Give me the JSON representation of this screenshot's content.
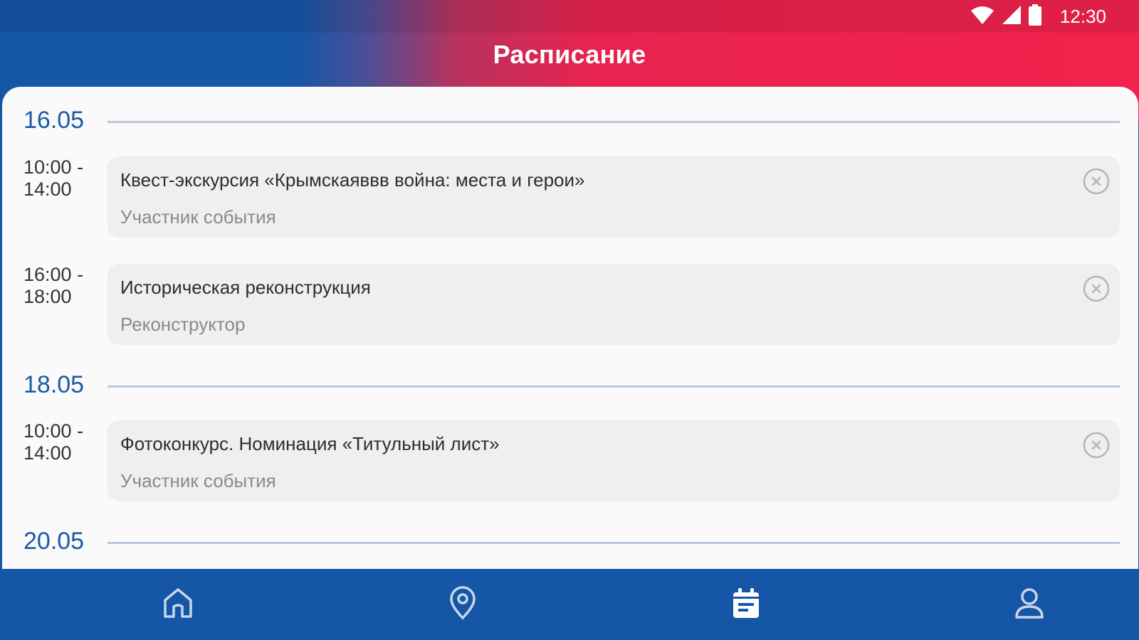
{
  "status_bar": {
    "time": "12:30",
    "icons": [
      "wifi-icon",
      "cellular-signal-icon",
      "battery-icon"
    ]
  },
  "header": {
    "title": "Расписание"
  },
  "schedule": [
    {
      "date": "16.05",
      "events": [
        {
          "time_start": "10:00 -",
          "time_end": "14:00",
          "title": "Квест-экскурсия «Крымскаяввв война: места и герои»",
          "role": "Участник события"
        },
        {
          "time_start": "16:00 -",
          "time_end": "18:00",
          "title": "Историческая реконструкция",
          "role": "Реконструктор"
        }
      ]
    },
    {
      "date": "18.05",
      "events": [
        {
          "time_start": "10:00 -",
          "time_end": "14:00",
          "title": "Фотоконкурс. Номинация «Титульный лист»",
          "role": "Участник события"
        }
      ]
    },
    {
      "date": "20.05",
      "events": []
    }
  ],
  "bottom_nav": {
    "items": [
      {
        "icon": "home-icon",
        "active": false
      },
      {
        "icon": "map-pin-icon",
        "active": false
      },
      {
        "icon": "calendar-icon",
        "active": true
      },
      {
        "icon": "profile-icon",
        "active": false
      }
    ]
  },
  "colors": {
    "brand_blue": "#1556a6",
    "brand_red": "#f2224c",
    "date_blue": "#1a5ba7",
    "card_bg": "#efefef",
    "content_bg": "#fafafa"
  }
}
